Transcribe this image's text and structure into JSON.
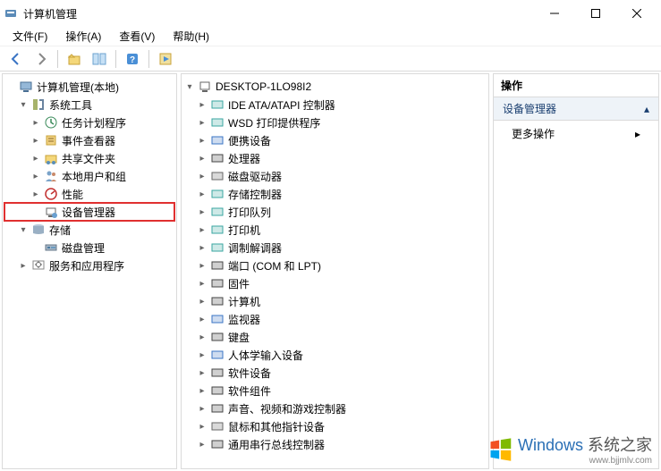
{
  "title": "计算机管理",
  "menu": {
    "file": "文件(F)",
    "action": "操作(A)",
    "view": "查看(V)",
    "help": "帮助(H)"
  },
  "leftTree": {
    "root": "计算机管理(本地)",
    "systemTools": {
      "label": "系统工具",
      "taskScheduler": "任务计划程序",
      "eventViewer": "事件查看器",
      "sharedFolders": "共享文件夹",
      "localUsers": "本地用户和组",
      "performance": "性能",
      "deviceManager": "设备管理器"
    },
    "storage": {
      "label": "存储",
      "diskMgmt": "磁盘管理"
    },
    "services": "服务和应用程序"
  },
  "midTree": {
    "root": "DESKTOP-1LO98I2",
    "items": [
      {
        "icon": "ide-icon",
        "color": "ic-teal",
        "label": "IDE ATA/ATAPI 控制器"
      },
      {
        "icon": "wsd-icon",
        "color": "ic-teal",
        "label": "WSD 打印提供程序"
      },
      {
        "icon": "portable-icon",
        "color": "ic-blue",
        "label": "便携设备"
      },
      {
        "icon": "cpu-icon",
        "color": "ic-dark",
        "label": "处理器"
      },
      {
        "icon": "disk-icon",
        "color": "ic-gray",
        "label": "磁盘驱动器"
      },
      {
        "icon": "storage-ctrl-icon",
        "color": "ic-teal",
        "label": "存储控制器"
      },
      {
        "icon": "print-queue-icon",
        "color": "ic-teal",
        "label": "打印队列"
      },
      {
        "icon": "printer-icon",
        "color": "ic-teal",
        "label": "打印机"
      },
      {
        "icon": "modem-icon",
        "color": "ic-teal",
        "label": "调制解调器"
      },
      {
        "icon": "ports-icon",
        "color": "ic-dark",
        "label": "端口 (COM 和 LPT)"
      },
      {
        "icon": "firmware-icon",
        "color": "ic-dark",
        "label": "固件"
      },
      {
        "icon": "computer-icon",
        "color": "ic-dark",
        "label": "计算机"
      },
      {
        "icon": "monitor-icon",
        "color": "ic-blue",
        "label": "监视器"
      },
      {
        "icon": "keyboard-icon",
        "color": "ic-dark",
        "label": "键盘"
      },
      {
        "icon": "hid-icon",
        "color": "ic-blue",
        "label": "人体学输入设备"
      },
      {
        "icon": "sw-device-icon",
        "color": "ic-dark",
        "label": "软件设备"
      },
      {
        "icon": "sw-component-icon",
        "color": "ic-dark",
        "label": "软件组件"
      },
      {
        "icon": "audio-icon",
        "color": "ic-dark",
        "label": "声音、视频和游戏控制器"
      },
      {
        "icon": "mouse-icon",
        "color": "ic-gray",
        "label": "鼠标和其他指针设备"
      },
      {
        "icon": "usb-icon",
        "color": "ic-dark",
        "label": "通用串行总线控制器"
      }
    ]
  },
  "actions": {
    "header": "操作",
    "sub": "设备管理器",
    "more": "更多操作"
  },
  "watermark": {
    "brand": "Windows",
    "site": "系统之家",
    "url": "www.bjjmlv.com"
  }
}
